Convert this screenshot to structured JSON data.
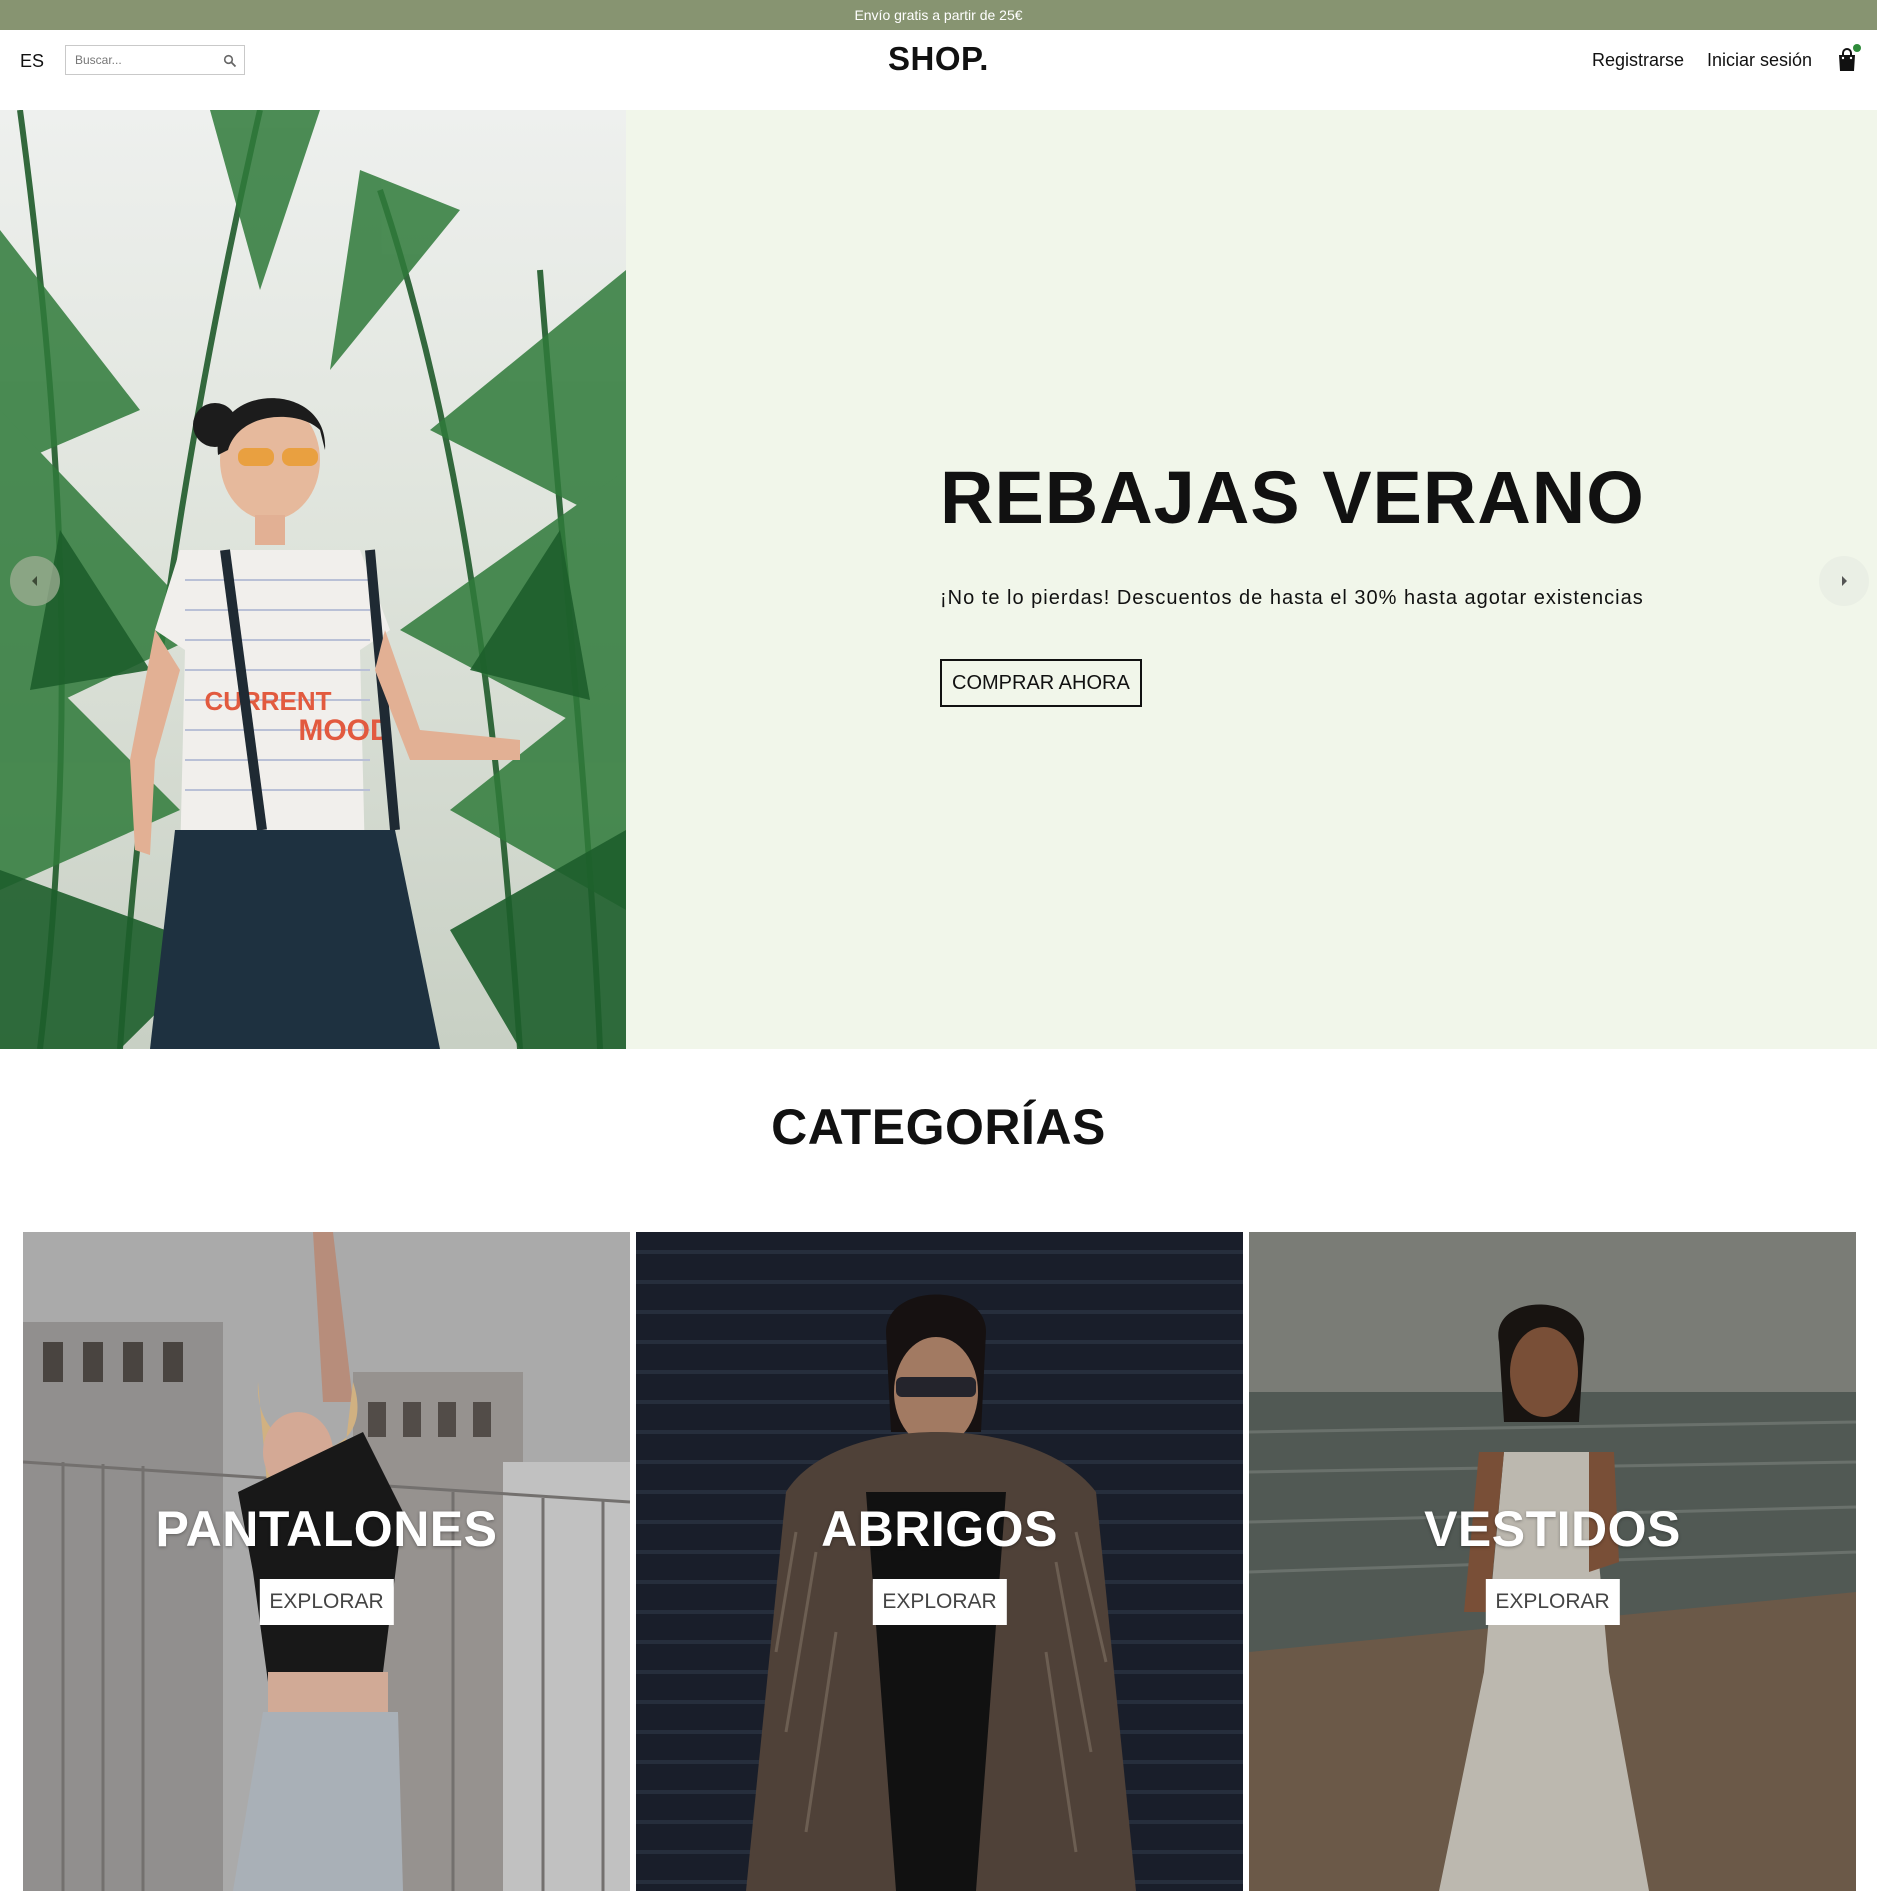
{
  "announcement": "Envío gratis a partir de 25€",
  "header": {
    "language": "ES",
    "search_placeholder": "Buscar...",
    "logo": "SHOP.",
    "register": "Registrarse",
    "login": "Iniciar sesión"
  },
  "hero": {
    "title": "REBAJAS VERANO",
    "subtitle": "¡No te lo pierdas! Descuentos de hasta el 30% hasta agotar existencias",
    "button": "COMPRAR AHORA",
    "image_text_1": "CURRENT",
    "image_text_2": "MOOD",
    "background": "#f1f6ea"
  },
  "categories": {
    "title": "CATEGORÍAS",
    "items": [
      {
        "label": "PANTALONES",
        "button": "EXPLORAR"
      },
      {
        "label": "ABRIGOS",
        "button": "EXPLORAR"
      },
      {
        "label": "VESTIDOS",
        "button": "EXPLORAR"
      }
    ]
  },
  "colors": {
    "announcement_bar": "#879471",
    "cart_badge": "#2e8b3a"
  }
}
